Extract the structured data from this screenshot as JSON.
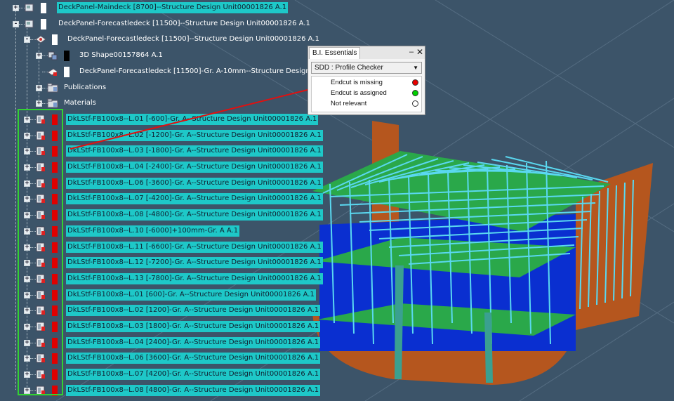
{
  "tree": {
    "items": [
      {
        "label": "DeckPanel-Maindeck [8700]--Structure Design Unit00001826 A.1",
        "depth": 0,
        "expander": "+",
        "icon": "panel-icon",
        "swatch": "#ffffff",
        "highlight": true
      },
      {
        "label": "DeckPanel-Forecastledeck [11500]--Structure Design Unit00001826 A.1",
        "depth": 0,
        "expander": "-",
        "icon": "panel-icon",
        "swatch": "#ffffff",
        "highlight": false
      },
      {
        "label": "DeckPanel-Forecastledeck [11500]--Structure Design Unit00001826 A.1",
        "depth": 1,
        "expander": "-",
        "icon": "plate-icon",
        "swatch": "#ffffff",
        "highlight": false
      },
      {
        "label": "3D Shape00157864 A.1",
        "depth": 2,
        "expander": "+",
        "icon": "shape-icon",
        "swatch": "#000000",
        "highlight": false
      },
      {
        "label": "DeckPanel-Forecastledeck [11500]-Gr. A-10mm--Structure Design Unit00001826 A.1",
        "depth": 2,
        "expander": "",
        "icon": "plate-red-icon",
        "swatch": "#ffffff",
        "highlight": false
      },
      {
        "label": "Publications",
        "depth": 2,
        "expander": "+",
        "icon": "folder-icon",
        "swatch": "",
        "highlight": false
      },
      {
        "label": "Materials",
        "depth": 2,
        "expander": "+",
        "icon": "folder-icon",
        "swatch": "",
        "highlight": false
      },
      {
        "label": "DkLStf-FB100x8--L.01 [-600]-Gr. A--Structure Design Unit00001826 A.1",
        "depth": 1,
        "expander": "+",
        "icon": "stiffener-icon",
        "swatch": "#e00000",
        "highlight": true
      },
      {
        "label": "DkLStf-FB100x8--L.02 [-1200]-Gr. A--Structure Design Unit00001826 A.1",
        "depth": 1,
        "expander": "+",
        "icon": "stiffener-icon",
        "swatch": "#e00000",
        "highlight": true
      },
      {
        "label": "DkLStf-FB100x8--L.03 [-1800]-Gr. A--Structure Design Unit00001826 A.1",
        "depth": 1,
        "expander": "+",
        "icon": "stiffener-icon",
        "swatch": "#e00000",
        "highlight": true
      },
      {
        "label": "DkLStf-FB100x8--L.04 [-2400]-Gr. A--Structure Design Unit00001826 A.1",
        "depth": 1,
        "expander": "+",
        "icon": "stiffener-icon",
        "swatch": "#e00000",
        "highlight": true
      },
      {
        "label": "DkLStf-FB100x8--L.06 [-3600]-Gr. A--Structure Design Unit00001826 A.1",
        "depth": 1,
        "expander": "+",
        "icon": "stiffener-icon",
        "swatch": "#e00000",
        "highlight": true
      },
      {
        "label": "DkLStf-FB100x8--L.07 [-4200]-Gr. A--Structure Design Unit00001826 A.1",
        "depth": 1,
        "expander": "+",
        "icon": "stiffener-icon",
        "swatch": "#e00000",
        "highlight": true
      },
      {
        "label": "DkLStf-FB100x8--L.08 [-4800]-Gr. A--Structure Design Unit00001826 A.1",
        "depth": 1,
        "expander": "+",
        "icon": "stiffener-icon",
        "swatch": "#e00000",
        "highlight": true
      },
      {
        "label": "DkLStf-FB100x8--L.10 [-6000]+100mm-Gr. A A.1",
        "depth": 1,
        "expander": "+",
        "icon": "stiffener-icon",
        "swatch": "#e00000",
        "highlight": true
      },
      {
        "label": "DkLStf-FB100x8--L.11 [-6600]-Gr. A--Structure Design Unit00001826 A.1",
        "depth": 1,
        "expander": "+",
        "icon": "stiffener-icon",
        "swatch": "#e00000",
        "highlight": true
      },
      {
        "label": "DkLStf-FB100x8--L.12 [-7200]-Gr. A--Structure Design Unit00001826 A.1",
        "depth": 1,
        "expander": "+",
        "icon": "stiffener-icon",
        "swatch": "#e00000",
        "highlight": true
      },
      {
        "label": "DkLStf-FB100x8--L.13 [-7800]-Gr. A--Structure Design Unit00001826 A.1",
        "depth": 1,
        "expander": "+",
        "icon": "stiffener-icon",
        "swatch": "#e00000",
        "highlight": true
      },
      {
        "label": "DkLStf-FB100x8--L.01 [600]-Gr. A--Structure Design Unit00001826 A.1",
        "depth": 1,
        "expander": "+",
        "icon": "stiffener-icon",
        "swatch": "#e00000",
        "highlight": true
      },
      {
        "label": "DkLStf-FB100x8--L.02 [1200]-Gr. A--Structure Design Unit00001826 A.1",
        "depth": 1,
        "expander": "+",
        "icon": "stiffener-icon",
        "swatch": "#e00000",
        "highlight": true
      },
      {
        "label": "DkLStf-FB100x8--L.03 [1800]-Gr. A--Structure Design Unit00001826 A.1",
        "depth": 1,
        "expander": "+",
        "icon": "stiffener-icon",
        "swatch": "#e00000",
        "highlight": true
      },
      {
        "label": "DkLStf-FB100x8--L.04 [2400]-Gr. A--Structure Design Unit00001826 A.1",
        "depth": 1,
        "expander": "+",
        "icon": "stiffener-icon",
        "swatch": "#e00000",
        "highlight": true
      },
      {
        "label": "DkLStf-FB100x8--L.06 [3600]-Gr. A--Structure Design Unit00001826 A.1",
        "depth": 1,
        "expander": "+",
        "icon": "stiffener-icon",
        "swatch": "#e00000",
        "highlight": true
      },
      {
        "label": "DkLStf-FB100x8--L.07 [4200]-Gr. A--Structure Design Unit00001826 A.1",
        "depth": 1,
        "expander": "+",
        "icon": "stiffener-icon",
        "swatch": "#e00000",
        "highlight": true
      },
      {
        "label": "DkLStf-FB100x8--L.08 [4800]-Gr. A--Structure Design Unit00001826 A.1",
        "depth": 1,
        "expander": "+",
        "icon": "stiffener-icon",
        "swatch": "#e00000",
        "highlight": true
      }
    ]
  },
  "dialog": {
    "title": "B.I. Essentials",
    "minimize_glyph": "–",
    "close_glyph": "✕",
    "select_value": "SDD : Profile Checker",
    "select_arrow": "▼",
    "legend": [
      {
        "text": "Endcut is missing",
        "color": "#e80000"
      },
      {
        "text": "Endcut is assigned",
        "color": "#00d000"
      },
      {
        "text": "Not relevant",
        "color": "#ffffff"
      }
    ]
  },
  "colors": {
    "background": "#3c5469",
    "highlight": "#1ec8c8",
    "group_box": "#32d232",
    "arrow": "#e01010",
    "hull": "#b5561e",
    "deck_green": "#2aa84a",
    "stiffener_cyan": "#5ad8f0",
    "plate_blue": "#0a2fd0"
  }
}
